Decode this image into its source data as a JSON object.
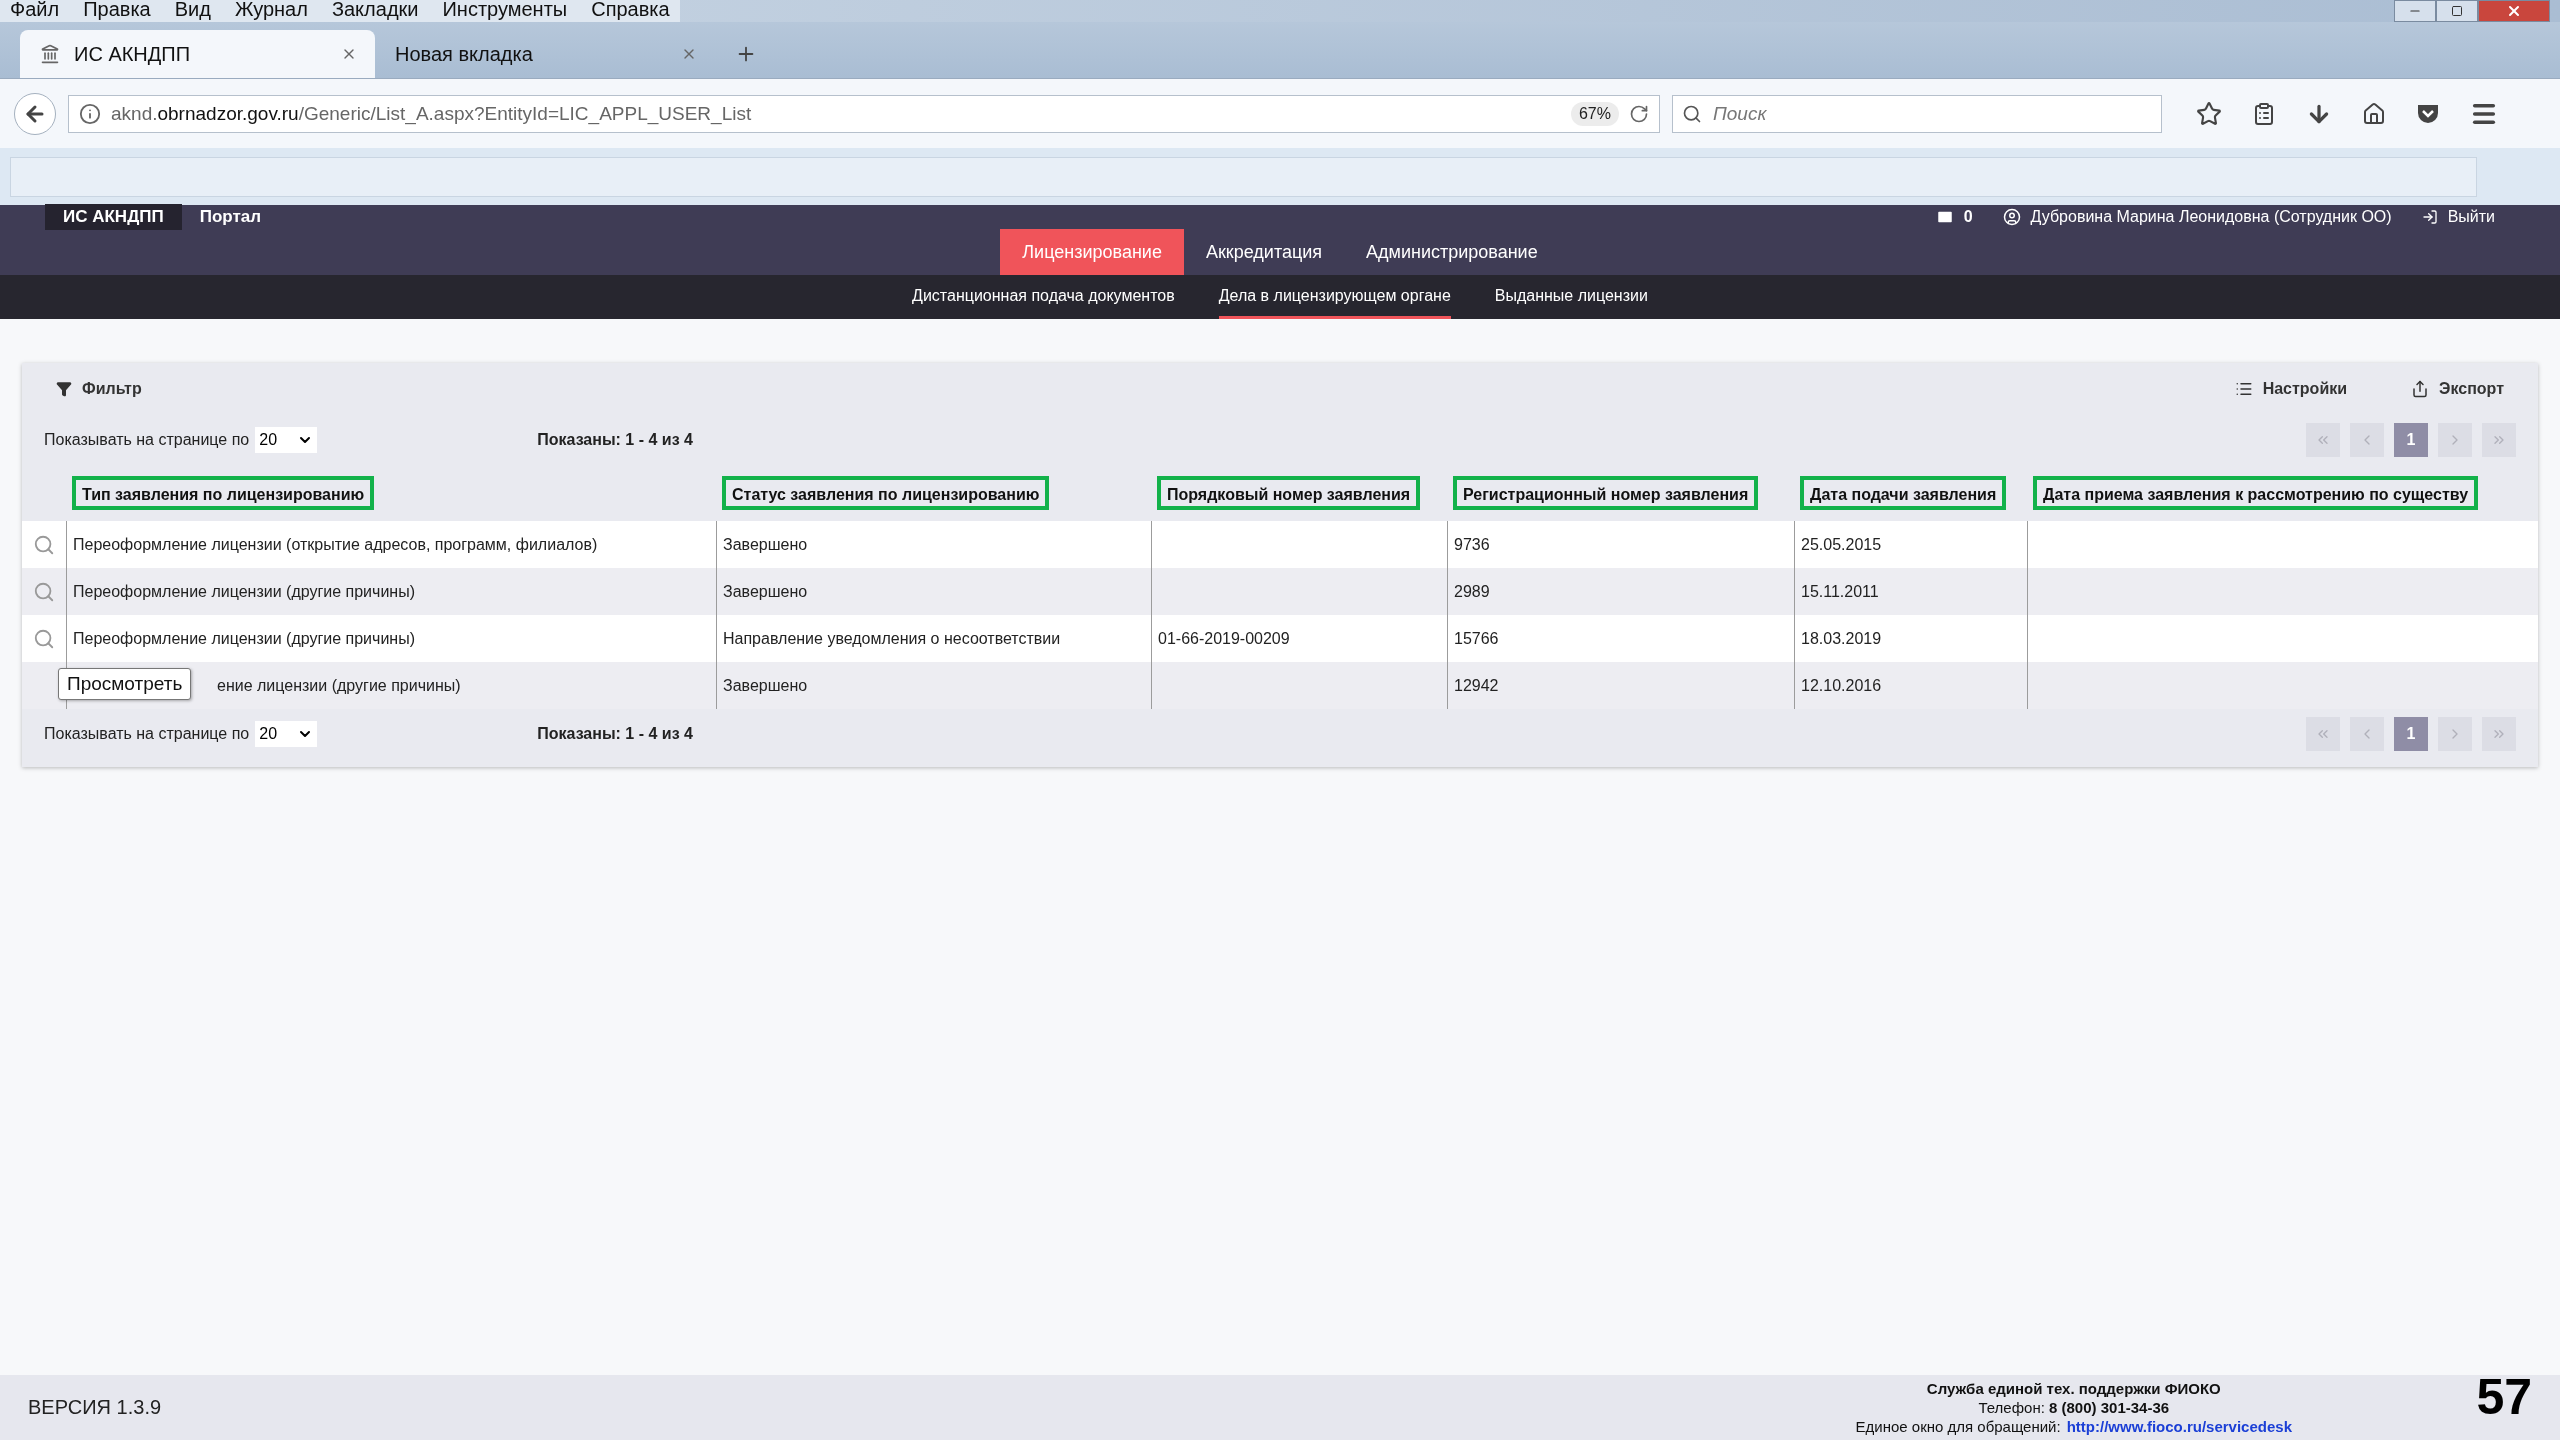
{
  "browser": {
    "menu": [
      "Файл",
      "Правка",
      "Вид",
      "Журнал",
      "Закладки",
      "Инструменты",
      "Справка"
    ],
    "tabs": [
      {
        "title": "ИС АКНДПП",
        "selected": true
      },
      {
        "title": "Новая вкладка",
        "selected": false
      }
    ],
    "url": {
      "prefix": "aknd.",
      "domain": "obrnadzor.gov.ru",
      "path": "/Generic/List_A.aspx?EntityId=LIC_APPL_USER_List"
    },
    "zoom": "67%",
    "search": {
      "placeholder": "Поиск"
    }
  },
  "app": {
    "brand": "ИС АКНДПП",
    "portal": "Портал",
    "messages": "0",
    "user": "Дубровина Марина Леонидовна (Сотрудник ОО)",
    "logout": "Выйти",
    "sections": [
      {
        "label": "Лицензирование",
        "selected": true
      },
      {
        "label": "Аккредитация",
        "selected": false
      },
      {
        "label": "Администрирование",
        "selected": false
      }
    ],
    "subsections": [
      {
        "label": "Дистанционная подача документов",
        "selected": false
      },
      {
        "label": "Дела в лицензирующем органе",
        "selected": true
      },
      {
        "label": "Выданные лицензии",
        "selected": false
      }
    ]
  },
  "list": {
    "filter": "Фильтр",
    "settings": "Настройки",
    "export": "Экспорт",
    "top_pager": {
      "page_size_label": "Показывать на странице по",
      "page_size": "20",
      "shown": "Показаны: 1 - 4 из 4",
      "pages": [
        {
          "label": "1",
          "selected": true
        }
      ]
    },
    "columns": [
      {
        "label": "Тип заявления по лицензированию",
        "highlighted": true
      },
      {
        "label": "Статус заявления по лицензированию",
        "highlighted": true
      },
      {
        "label": "Порядковый номер заявления",
        "highlighted": true
      },
      {
        "label": "Регистрационный номер заявления",
        "highlighted": true
      },
      {
        "label": "Дата подачи заявления",
        "highlighted": true
      },
      {
        "label": "Дата приема заявления к рассмотрению по существу",
        "highlighted": true
      }
    ],
    "rows": [
      {
        "cells": [
          "Переоформление лицензии (открытие адресов, программ, филиалов)",
          "Завершено",
          "",
          "9736",
          "25.05.2015",
          ""
        ]
      },
      {
        "cells": [
          "Переоформление лицензии (другие причины)",
          "Завершено",
          "",
          "2989",
          "15.11.2011",
          ""
        ]
      },
      {
        "cells": [
          "Переоформление лицензии (другие причины)",
          "Направление уведомления о несоответствии",
          "01-66-2019-00209",
          "15766",
          "18.03.2019",
          ""
        ]
      },
      {
        "cells": [
          "ение лицензии (другие причины)",
          "Завершено",
          "",
          "12942",
          "12.10.2016",
          ""
        ],
        "tooltip": "Просмотреть"
      }
    ],
    "bottom_pager": {
      "page_size_label": "Показывать на странице по",
      "page_size": "20",
      "shown": "Показаны: 1 - 4 из 4",
      "pages": [
        {
          "label": "1",
          "selected": true
        }
      ]
    }
  },
  "footer": {
    "version": "ВЕРСИЯ 1.3.9",
    "support_title": "Служба единой тех. поддержки ФИОКО",
    "phone": "Телефон: **8 (800) 301-34-36**",
    "window_label": "Единое окно для обращений:",
    "link": "http://www.fioco.ru/servicedesk"
  },
  "slide_number": "57"
}
